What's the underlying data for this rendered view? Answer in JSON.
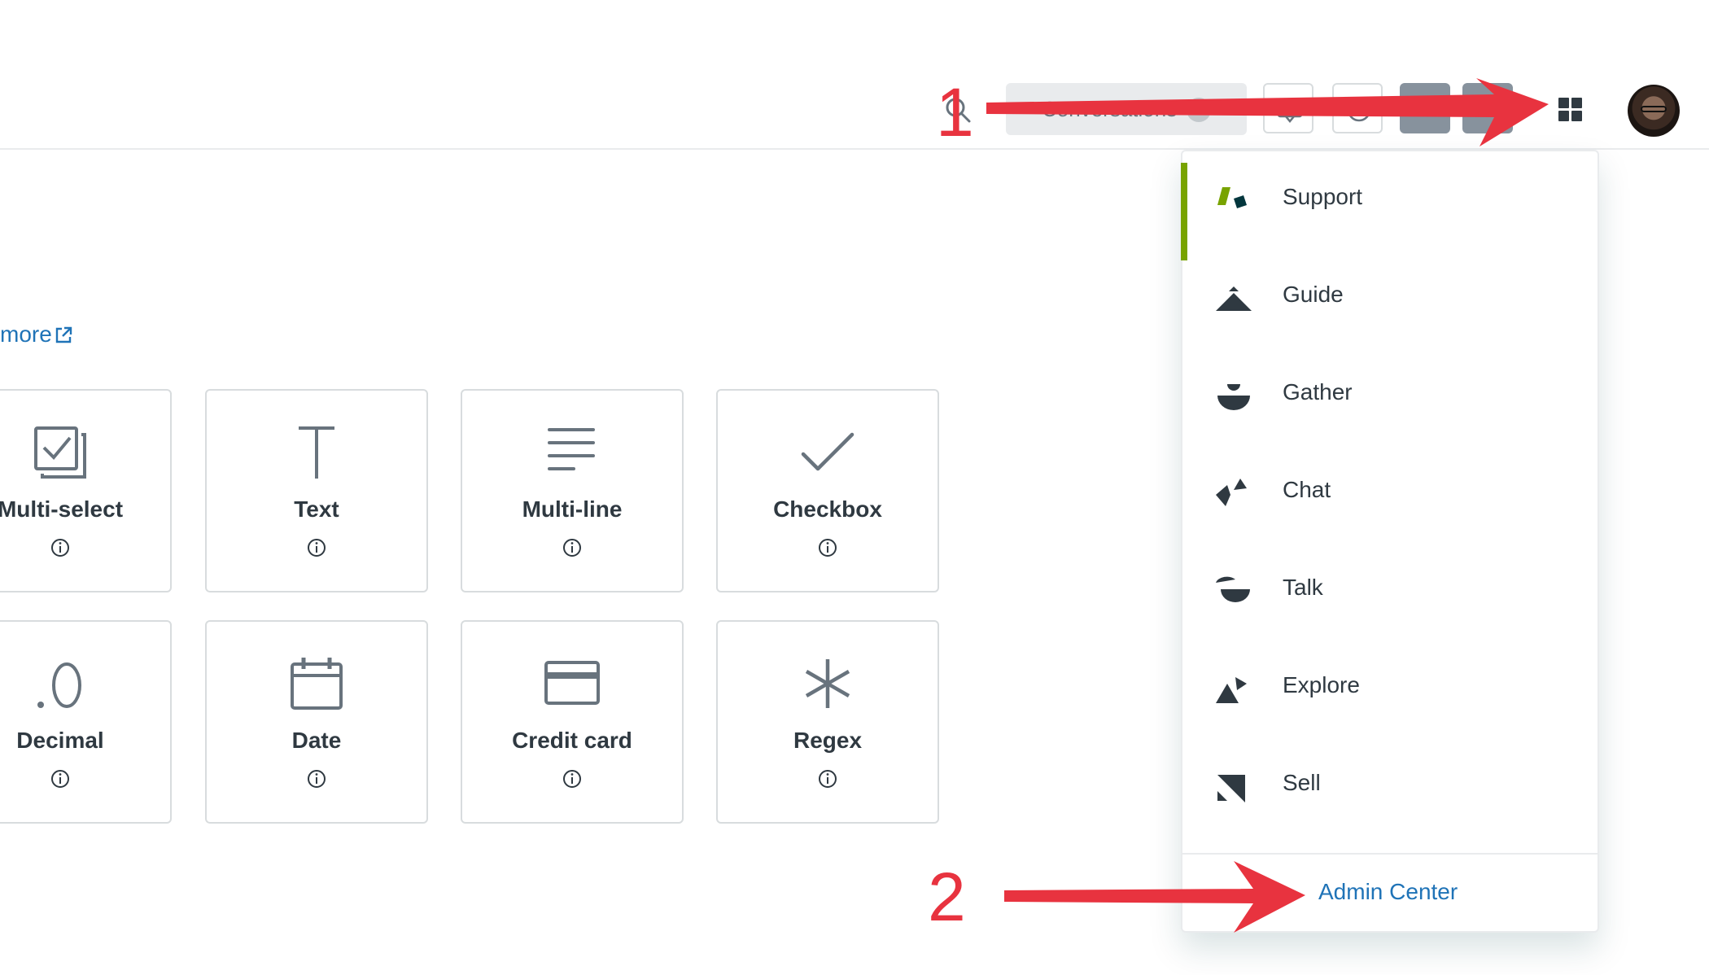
{
  "header": {
    "search_placeholder": "Conversations",
    "icons": [
      "search-icon",
      "chat-icon",
      "help-icon",
      "apps-grid-icon",
      "avatar"
    ]
  },
  "learn_more": {
    "label": "more"
  },
  "field_types": [
    {
      "label": "Multi-select",
      "icon": "multi-select-icon"
    },
    {
      "label": "Text",
      "icon": "text-icon"
    },
    {
      "label": "Multi-line",
      "icon": "multi-line-icon"
    },
    {
      "label": "Checkbox",
      "icon": "checkbox-icon"
    },
    {
      "label": "Decimal",
      "icon": "decimal-icon"
    },
    {
      "label": "Date",
      "icon": "calendar-icon"
    },
    {
      "label": "Credit card",
      "icon": "credit-card-icon"
    },
    {
      "label": "Regex",
      "icon": "asterisk-icon"
    }
  ],
  "product_tray": {
    "items": [
      {
        "label": "Support",
        "icon": "support-logo-icon",
        "active": true
      },
      {
        "label": "Guide",
        "icon": "guide-logo-icon"
      },
      {
        "label": "Gather",
        "icon": "gather-logo-icon"
      },
      {
        "label": "Chat",
        "icon": "chat-logo-icon"
      },
      {
        "label": "Talk",
        "icon": "talk-logo-icon"
      },
      {
        "label": "Explore",
        "icon": "explore-logo-icon"
      },
      {
        "label": "Sell",
        "icon": "sell-logo-icon"
      }
    ],
    "admin_link": "Admin Center"
  },
  "annotations": {
    "step1": "1",
    "step2": "2"
  },
  "colors": {
    "accent_green": "#78a300",
    "link_blue": "#1f73b7",
    "annotation_red": "#e8333f"
  }
}
